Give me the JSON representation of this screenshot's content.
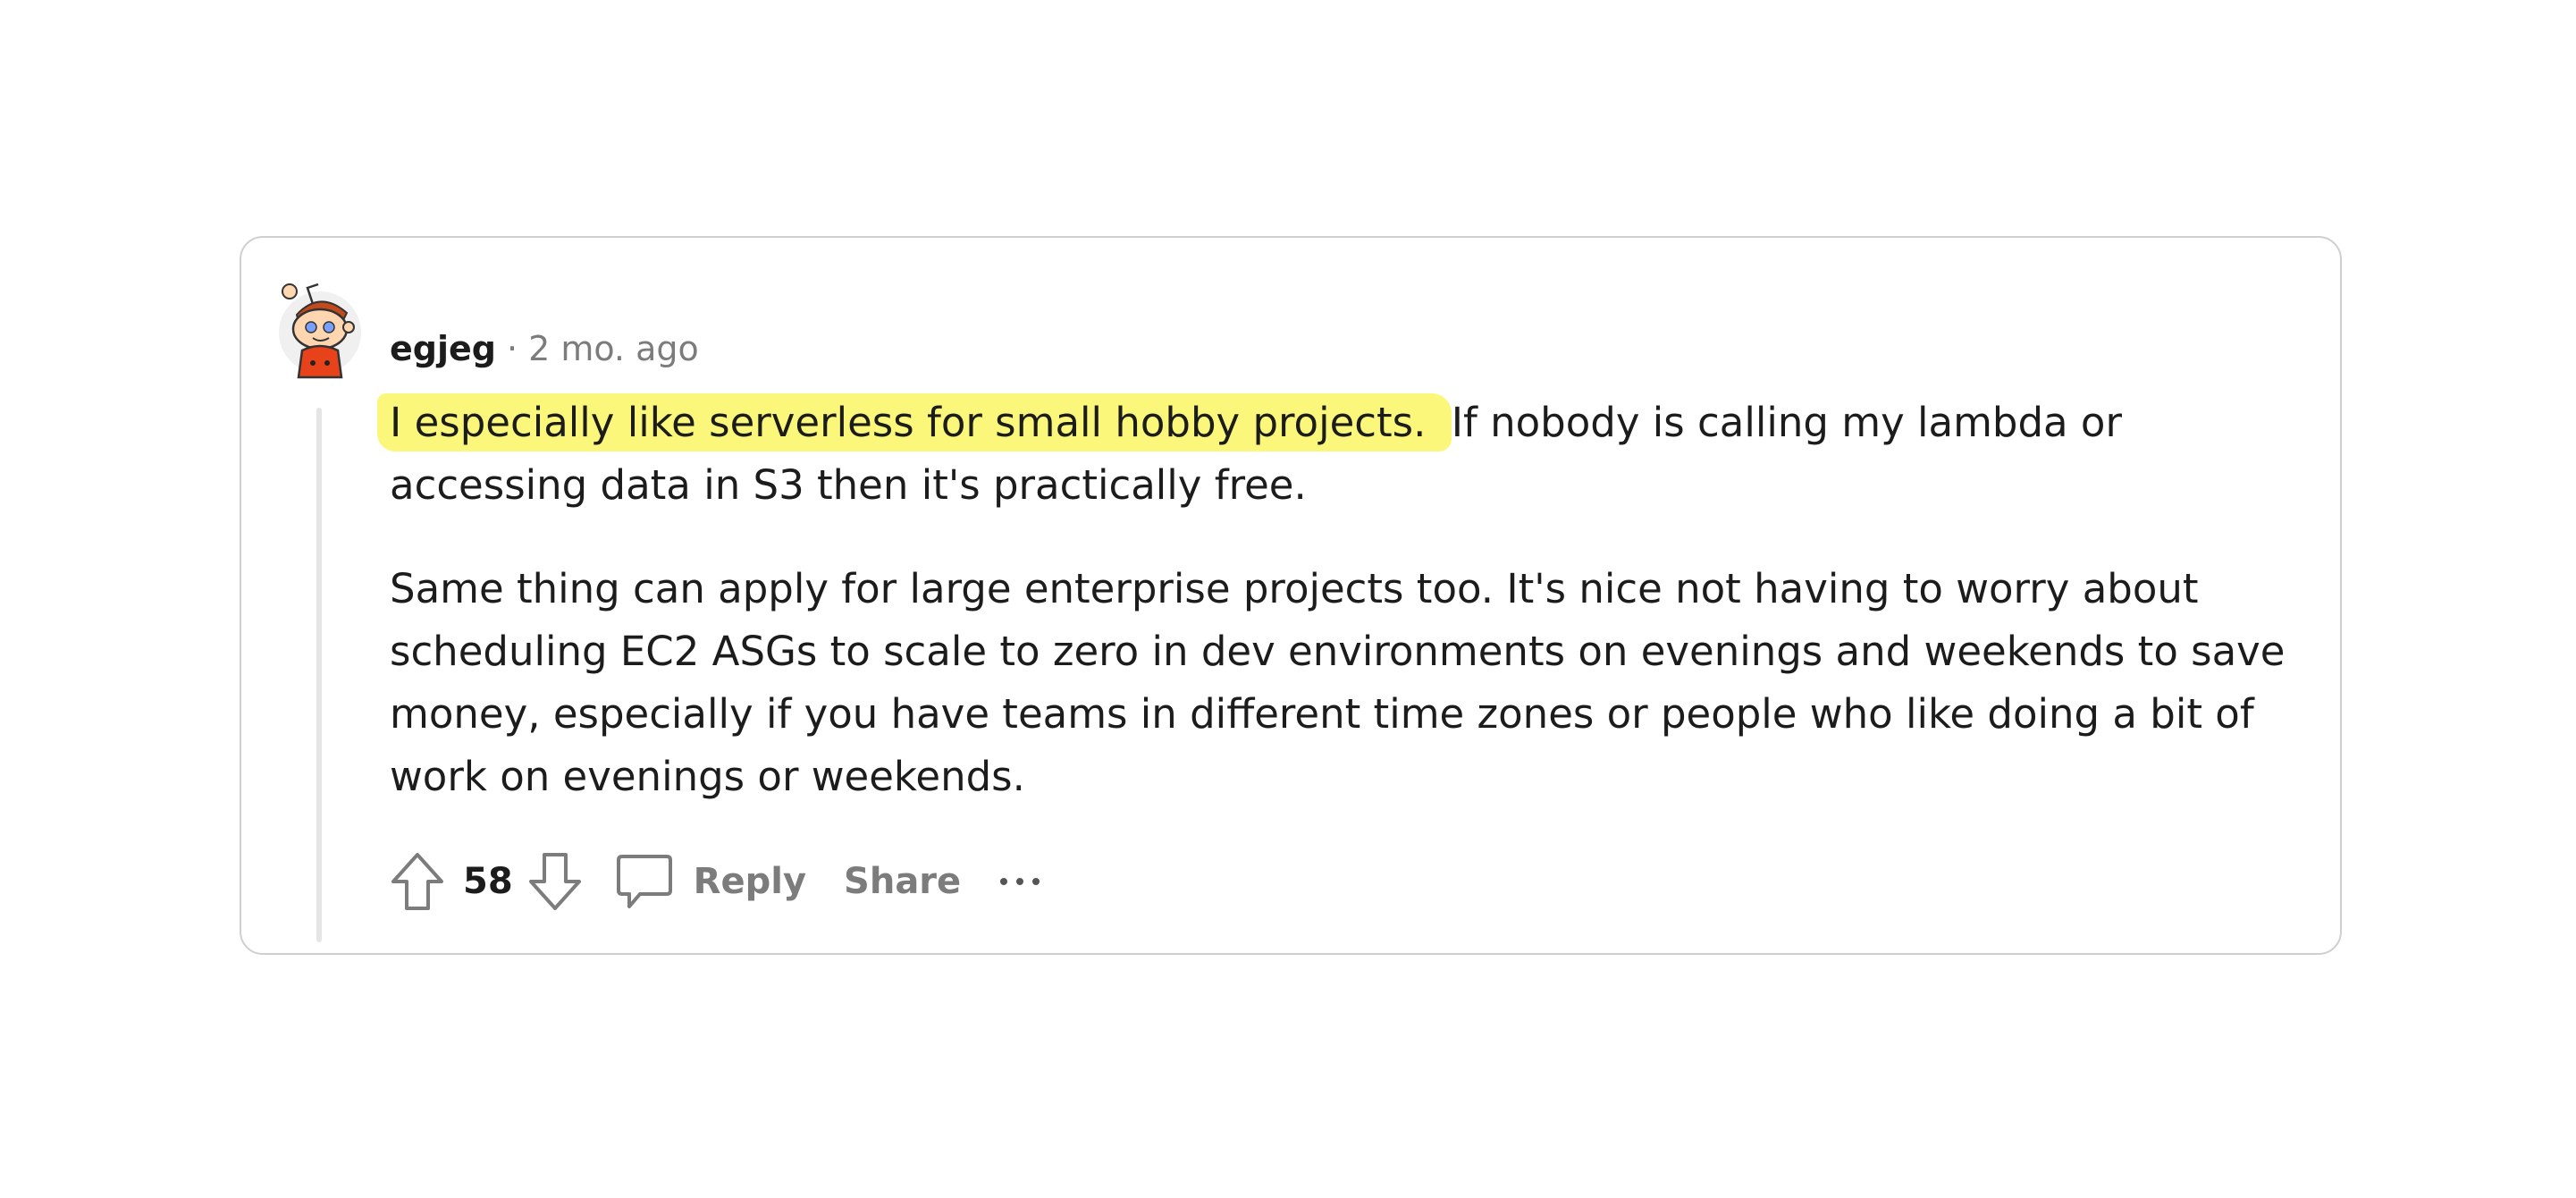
{
  "comment": {
    "author": "egjeg",
    "separator": "·",
    "time": "2 mo. ago",
    "body": {
      "p1_highlight": "I especially like serverless for small hobby projects. ",
      "p1_rest": "If nobody is calling my lambda or accessing data in S3 then it's practically free.",
      "p2": "Same thing can apply for large enterprise projects too. It's nice not having to worry about scheduling EC2 ASGs to scale to zero in dev environments on evenings and weekends to save money, especially if you have teams in different time zones or people who like doing a bit of work on evenings or weekends."
    },
    "highlight_color": "#fbf77b"
  },
  "actions": {
    "score": "58",
    "reply_label": "Reply",
    "share_label": "Share",
    "icons": [
      "upvote-icon",
      "downvote-icon",
      "comment-icon",
      "more-options-icon"
    ]
  },
  "colors": {
    "text": "#1c1c1c",
    "muted": "#7c7c7c",
    "border": "#cfcfcf",
    "avatar_shirt": "#e8421a"
  }
}
